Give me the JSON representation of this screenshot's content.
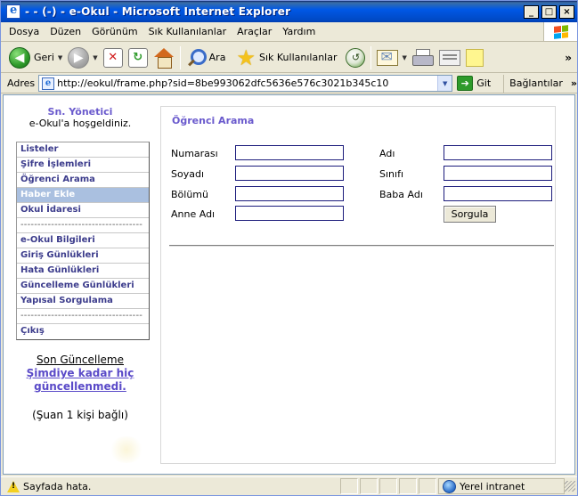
{
  "window": {
    "title": "- - (-) - e-Okul  - Microsoft Internet Explorer",
    "controls": [
      "_",
      "□",
      "×"
    ]
  },
  "menubar": {
    "items": [
      "Dosya",
      "Düzen",
      "Görünüm",
      "Sık Kullanılanlar",
      "Araçlar",
      "Yardım"
    ]
  },
  "toolbar": {
    "back_label": "Geri",
    "search_label": "Ara",
    "favorites_label": "Sık Kullanılanlar"
  },
  "addressbar": {
    "label": "Adres",
    "url": "http://eokul/frame.php?sid=8be993062dfc5636e576c3021b345c10",
    "go_label": "Git",
    "links_label": "Bağlantılar"
  },
  "sidebar": {
    "admin_title": "Sn. Yönetici",
    "welcome": "e-Okul'a hoşgeldiniz.",
    "items": [
      "Listeler",
      "Şifre İşlemleri",
      "Öğrenci Arama",
      "Haber Ekle",
      "Okul İdaresi",
      "------------------------------------",
      "e-Okul Bilgileri",
      "Giriş Günlükleri",
      "Hata Günlükleri",
      "Güncelleme Günlükleri",
      "Yapısal Sorgulama",
      "------------------------------------",
      "Çıkış"
    ],
    "active_item": "Haber Ekle",
    "last_update_title": "Son Güncelleme",
    "last_update_text_line1": "Şimdiye kadar hiç",
    "last_update_text_line2": "güncellenmedi.",
    "online_text": "(Şuan 1 kişi bağlı)"
  },
  "search_form": {
    "title": "Öğrenci Arama",
    "fields": {
      "numara_label": "Numarası",
      "soyad_label": "Soyadı",
      "bolum_label": "Bölümü",
      "anne_label": "Anne Adı",
      "ad_label": "Adı",
      "sinif_label": "Sınıfı",
      "baba_label": "Baba Adı"
    },
    "values": {
      "numara": "",
      "soyad": "",
      "bolum": "",
      "anne": "",
      "ad": "",
      "sinif": "",
      "baba": ""
    },
    "submit_label": "Sorgula"
  },
  "statusbar": {
    "text": "Sayfada hata.",
    "zone": "Yerel intranet"
  },
  "colors": {
    "accent_purple": "#6a5acd",
    "menu_active_bg": "#aac0e0",
    "titlebar_blue": "#0058e6"
  }
}
